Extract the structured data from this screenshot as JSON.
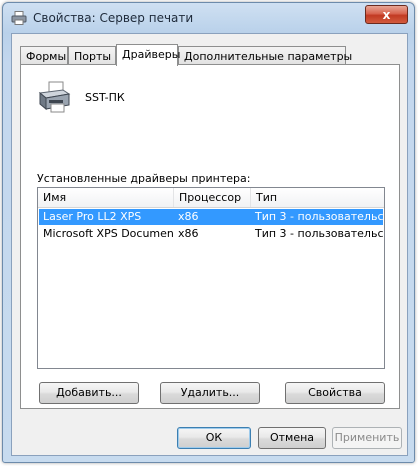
{
  "window": {
    "title": "Свойства: Сервер печати",
    "close_label": "x"
  },
  "tabs": [
    {
      "label": "Формы"
    },
    {
      "label": "Порты"
    },
    {
      "label": "Драйверы"
    },
    {
      "label": "Дополнительные параметры"
    }
  ],
  "active_tab": "Драйверы",
  "server_name": "SST-ПК",
  "section_label": "Установленные драйверы принтера:",
  "drivers_table": {
    "columns": [
      "Имя",
      "Процессор",
      "Тип"
    ],
    "rows": [
      {
        "name": "Laser Pro LL2 XPS",
        "processor": "x86",
        "type": "Тип 3 - пользовательс...",
        "selected": true
      },
      {
        "name": "Microsoft XPS Documen...",
        "processor": "x86",
        "type": "Тип 3 - пользовательс...",
        "selected": false
      }
    ]
  },
  "buttons": {
    "add": "Добавить...",
    "remove": "Удалить...",
    "properties": "Свойства",
    "ok": "ОК",
    "cancel": "Отмена",
    "apply": "Применить"
  },
  "colors": {
    "selection": "#3399ff",
    "close_button": "#c23a23"
  }
}
